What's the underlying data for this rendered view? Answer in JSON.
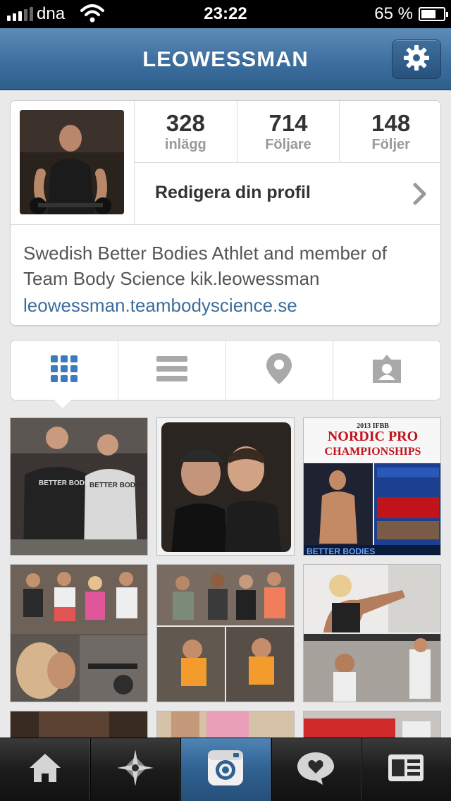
{
  "status_bar": {
    "carrier": "dna",
    "time": "23:22",
    "battery": "65 %"
  },
  "nav": {
    "title": "LEOWESSMAN",
    "settings_icon": "gear-icon"
  },
  "profile": {
    "stats": [
      {
        "value": "328",
        "label": "inlägg"
      },
      {
        "value": "714",
        "label": "Följare"
      },
      {
        "value": "148",
        "label": "Följer"
      }
    ],
    "edit_label": "Redigera din profil",
    "bio_line1": "Swedish Better Bodies Athlet and member of",
    "bio_line2": "Team Body Science kik.leowessman",
    "website": "leowessman.teambodyscience.se"
  },
  "view_tabs": [
    {
      "icon": "grid-icon",
      "active": true
    },
    {
      "icon": "list-icon",
      "active": false
    },
    {
      "icon": "map-pin-icon",
      "active": false
    },
    {
      "icon": "photos-of-me-icon",
      "active": false
    }
  ],
  "photos": {
    "poster_line1": "2013 IFBB",
    "poster_line2": "NORDIC PRO",
    "poster_line3": "CHAMPIONSHIPS",
    "poster_footer": "BETTER BODIES",
    "shirt_text_1": "BETTER BODIES",
    "shirt_text_2": "BETTER BODIES"
  },
  "tab_bar": [
    {
      "icon": "home-icon",
      "active": false
    },
    {
      "icon": "explore-icon",
      "active": false
    },
    {
      "icon": "camera-icon",
      "active": true
    },
    {
      "icon": "activity-icon",
      "active": false
    },
    {
      "icon": "profile-icon",
      "active": false
    }
  ],
  "colors": {
    "nav_blue": "#3d6f9f",
    "link_blue": "#3b6d9c",
    "active_tab_blue": "#2f6191"
  }
}
